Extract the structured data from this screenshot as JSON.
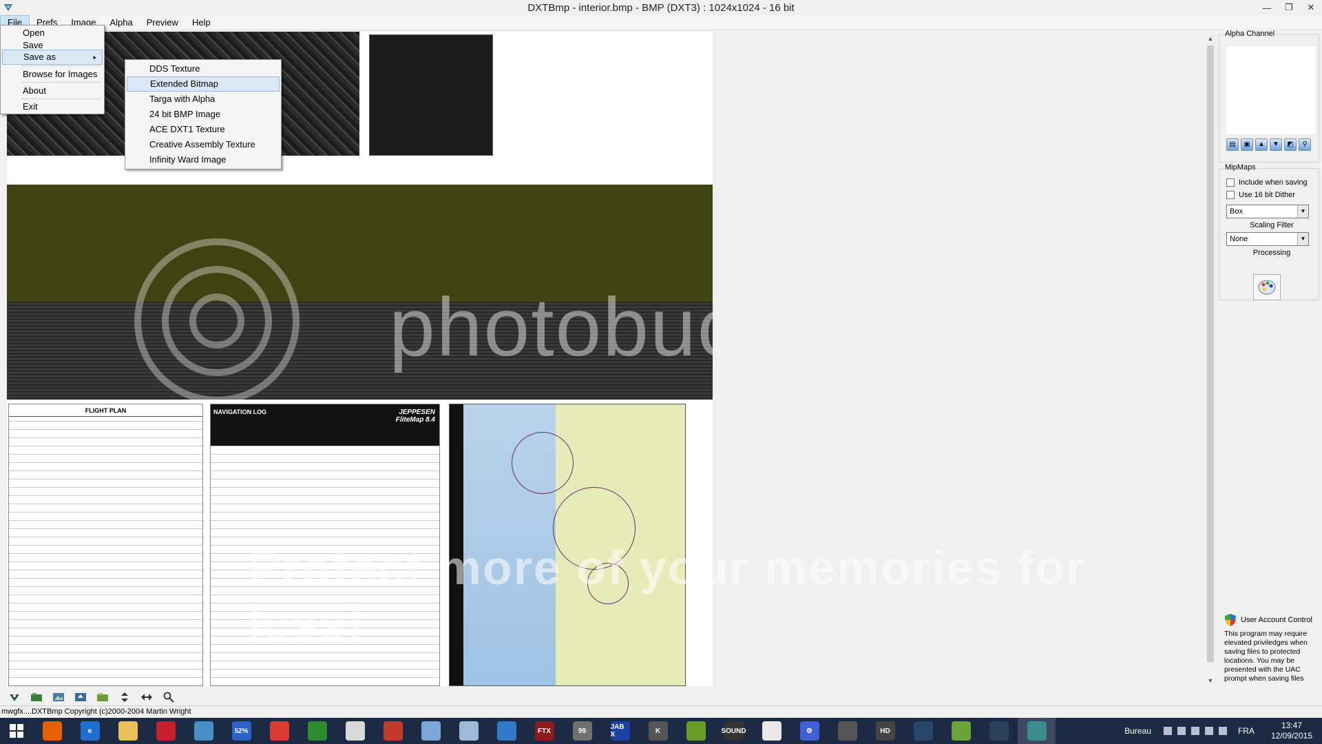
{
  "window": {
    "title": "DXTBmp - interior.bmp - BMP (DXT3) : 1024x1024 - 16 bit",
    "min_glyph": "—",
    "max_glyph": "❐",
    "close_glyph": "✕"
  },
  "menubar": {
    "items": [
      "File",
      "Prefs",
      "Image",
      "Alpha",
      "Preview",
      "Help"
    ]
  },
  "file_menu": {
    "items": [
      "Open",
      "Save",
      "Save as",
      "Browse for Images",
      "About",
      "Exit"
    ],
    "submenu_arrow": "▸"
  },
  "saveas_menu": {
    "items": [
      "DDS Texture",
      "Extended Bitmap",
      "Targa with Alpha",
      " 24 bit BMP Image",
      "ACE DXT1 Texture",
      "Creative Assembly Texture",
      "Infinity Ward Image"
    ],
    "highlighted": "Extended Bitmap"
  },
  "image_content": {
    "flight_plan_title": "FLIGHT PLAN",
    "nav_log_title": "NAVIGATION LOG",
    "jeppesen_brand": "JEPPESEN",
    "jeppesen_product": "FliteMap 8.4"
  },
  "watermark": {
    "text": "photobucket",
    "tagline": "Protect more of your memories for less!"
  },
  "right_panel": {
    "alpha_channel_label": "Alpha Channel",
    "mipmaps_label": "MipMaps",
    "include_when_saving": "Include when saving",
    "use_16bit_dither": "Use 16 bit Dither",
    "mip_filter_value": "Box",
    "scaling_filter_label": "Scaling Filter",
    "scaling_filter_value": "None",
    "processing_label": "Processing",
    "uac_title": "User Account Control",
    "uac_text": "This program may require elevated priviledges when saving files to protected locations. You may be presented with the UAC prompt when saving files"
  },
  "statusbar": {
    "text": "mwgfx....DXTBmp Copyright (c)2000-2004 Martin Wright"
  },
  "taskbar": {
    "apps": [
      {
        "name": "firefox",
        "color": "#e66000",
        "label": ""
      },
      {
        "name": "internet-explorer",
        "color": "#1e6fd0",
        "label": "e"
      },
      {
        "name": "file-explorer",
        "color": "#e8c05a",
        "label": ""
      },
      {
        "name": "red-app",
        "color": "#c8202a",
        "label": ""
      },
      {
        "name": "globe-app",
        "color": "#4a8ec8",
        "label": ""
      },
      {
        "name": "triangle-app",
        "color": "#2a62c8",
        "label": "52%"
      },
      {
        "name": "chrome",
        "color": "#d83b2f",
        "label": ""
      },
      {
        "name": "green-app",
        "color": "#2e8b2e",
        "label": ""
      },
      {
        "name": "eraser-app",
        "color": "#d8d8d8",
        "label": ""
      },
      {
        "name": "toolbox-app",
        "color": "#c0392b",
        "label": ""
      },
      {
        "name": "calculator-app",
        "color": "#7aa7d8",
        "label": ""
      },
      {
        "name": "document-app",
        "color": "#9db8d8",
        "label": ""
      },
      {
        "name": "mail-app",
        "color": "#2f7ac8",
        "label": ""
      },
      {
        "name": "ftx-app",
        "color": "#8b1a1a",
        "label": "FTX"
      },
      {
        "name": "screen-app",
        "color": "#707070",
        "label": "99"
      },
      {
        "name": "jabx-app",
        "color": "#1d3fa8",
        "label": "JAB X"
      },
      {
        "name": "k-app",
        "color": "#555555",
        "label": "K"
      },
      {
        "name": "nvidia-app",
        "color": "#6a9c2a",
        "label": ""
      },
      {
        "name": "sound-app",
        "color": "#333333",
        "label": "SOUND"
      },
      {
        "name": "plane-app",
        "color": "#e8e8e8",
        "label": ""
      },
      {
        "name": "settings-app",
        "color": "#3f5fd8",
        "label": "⚙"
      },
      {
        "name": "gray-app",
        "color": "#555555",
        "label": ""
      },
      {
        "name": "hd-app",
        "color": "#444444",
        "label": "HD"
      },
      {
        "name": "orb-app",
        "color": "#28466a",
        "label": ""
      },
      {
        "name": "glider-app",
        "color": "#6aa23a",
        "label": ""
      },
      {
        "name": "steam",
        "color": "#2a3f5a",
        "label": ""
      },
      {
        "name": "dxtbmp",
        "color": "#3a8a8a",
        "label": ""
      }
    ],
    "active_app": "dxtbmp",
    "desktop_label": "Bureau",
    "language": "FRA",
    "time": "13:47",
    "date": "12/09/2015"
  },
  "colors": {
    "menu_highlight": "#dbe9f7",
    "taskbar_bg": "#1c2a43",
    "olive": "#3f4312"
  }
}
